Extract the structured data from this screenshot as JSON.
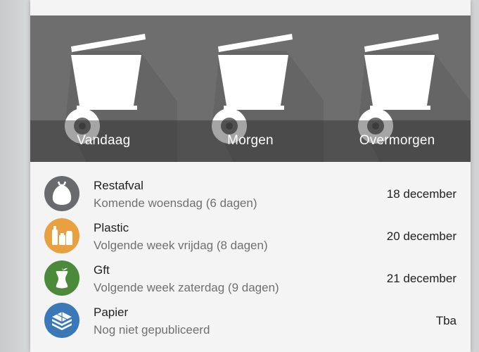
{
  "tiles": [
    {
      "label": "Vandaag"
    },
    {
      "label": "Morgen"
    },
    {
      "label": "Overmorgen"
    }
  ],
  "items": [
    {
      "title": "Restafval",
      "subtitle": "Komende woensdag (6 dagen)",
      "date": "18 december",
      "icon": "garbage-bag-icon",
      "color": "#696a6e"
    },
    {
      "title": "Plastic",
      "subtitle": "Volgende week vrijdag (8 dagen)",
      "date": "20 december",
      "icon": "plastic-bottles-icon",
      "color": "#e8a040"
    },
    {
      "title": "Gft",
      "subtitle": "Volgende week zaterdag (9 dagen)",
      "date": "21 december",
      "icon": "apple-core-icon",
      "color": "#4a8a3a"
    },
    {
      "title": "Papier",
      "subtitle": "Nog niet gepubliceerd",
      "date": "Tba",
      "icon": "paper-stack-icon",
      "color": "#3a78b8"
    }
  ]
}
